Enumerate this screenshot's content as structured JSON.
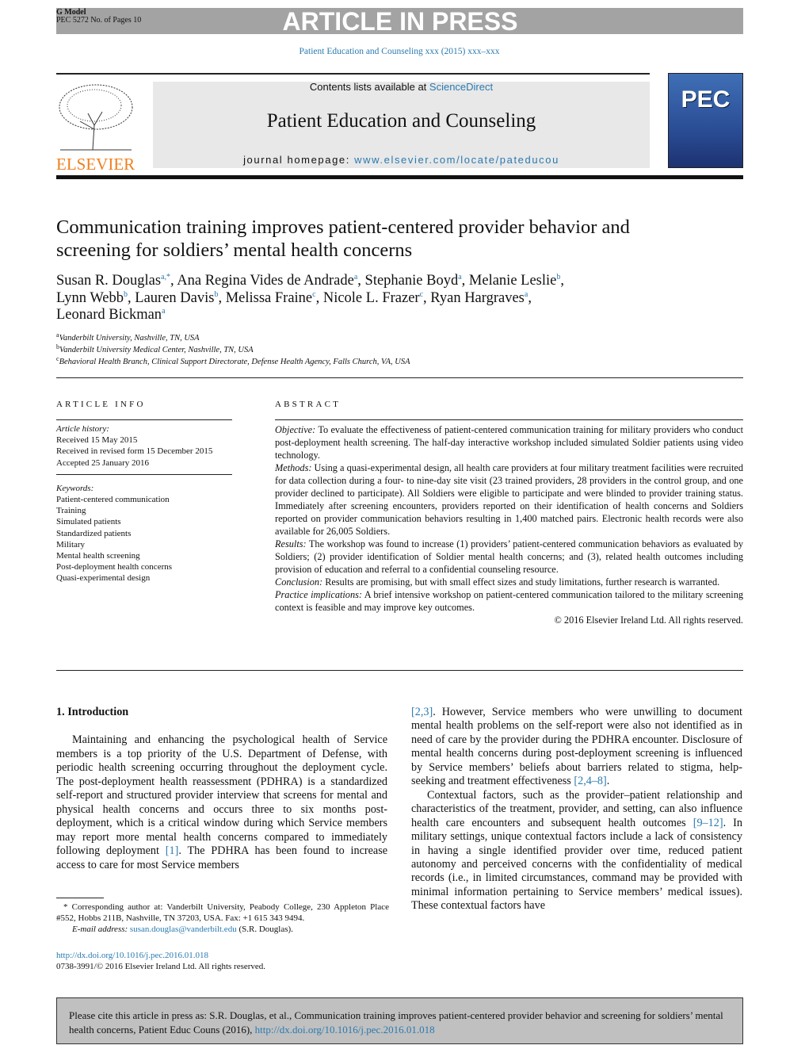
{
  "header": {
    "gmodel": "G Model",
    "pec_pages": "PEC 5272 No. of Pages 10",
    "banner": "ARTICLE IN PRESS",
    "journal_ref": "Patient Education and Counseling xxx (2015) xxx–xxx",
    "contents_prefix": "Contents lists available at ",
    "sciencedirect": "ScienceDirect",
    "journal_title": "Patient Education and Counseling",
    "homepage_prefix": "journal homepage: ",
    "homepage_url": "www.elsevier.com/locate/pateducou",
    "publisher_logo": "ELSEVIER",
    "cover_logo": "PEC"
  },
  "article": {
    "title": "Communication training improves patient-centered provider behavior and screening for soldiers’ mental health concerns",
    "authors": [
      {
        "name": "Susan R. Douglas",
        "sup": "a,*"
      },
      {
        "name": "Ana Regina Vides de Andrade",
        "sup": "a"
      },
      {
        "name": "Stephanie Boyd",
        "sup": "a"
      },
      {
        "name": "Melanie Leslie",
        "sup": "b"
      },
      {
        "name": "Lynn Webb",
        "sup": "b"
      },
      {
        "name": "Lauren Davis",
        "sup": "b"
      },
      {
        "name": "Melissa Fraine",
        "sup": "c"
      },
      {
        "name": "Nicole L. Frazer",
        "sup": "c"
      },
      {
        "name": "Ryan Hargraves",
        "sup": "a"
      },
      {
        "name": "Leonard Bickman",
        "sup": "a"
      }
    ],
    "affiliations": [
      {
        "sup": "a",
        "text": "Vanderbilt University, Nashville, TN, USA"
      },
      {
        "sup": "b",
        "text": "Vanderbilt University Medical Center, Nashville, TN, USA"
      },
      {
        "sup": "c",
        "text": "Behavioral Health Branch, Clinical Support Directorate, Defense Health Agency, Falls Church, VA, USA"
      }
    ]
  },
  "article_info": {
    "heading": "ARTICLE INFO",
    "history_label": "Article history:",
    "history": [
      "Received 15 May 2015",
      "Received in revised form 15 December 2015",
      "Accepted 25 January 2016"
    ],
    "keywords_label": "Keywords:",
    "keywords": [
      "Patient-centered communication",
      "Training",
      "Simulated patients",
      "Standardized patients",
      "Military",
      "Mental health screening",
      "Post-deployment health concerns",
      "Quasi-experimental design"
    ]
  },
  "abstract": {
    "heading": "ABSTRACT",
    "sections": [
      {
        "label": "Objective:",
        "text": " To evaluate the effectiveness of patient-centered communication training for military providers who conduct post-deployment health screening. The half-day interactive workshop included simulated Soldier patients using video technology."
      },
      {
        "label": "Methods:",
        "text": " Using a quasi-experimental design, all health care providers at four military treatment facilities were recruited for data collection during a four- to nine-day site visit (23 trained providers, 28 providers in the control group, and one provider declined to participate). All Soldiers were eligible to participate and were blinded to provider training status. Immediately after screening encounters, providers reported on their identification of health concerns and Soldiers reported on provider communication behaviors resulting in 1,400 matched pairs. Electronic health records were also available for 26,005 Soldiers."
      },
      {
        "label": "Results:",
        "text": " The workshop was found to increase (1) providers’ patient-centered communication behaviors as evaluated by Soldiers; (2) provider identification of Soldier mental health concerns; and (3), related health outcomes including provision of education and referral to a confidential counseling resource."
      },
      {
        "label": "Conclusion:",
        "text": " Results are promising, but with small effect sizes and study limitations, further research is warranted."
      },
      {
        "label": "Practice implications:",
        "text": " A brief intensive workshop on patient-centered communication tailored to the military screening context is feasible and may improve key outcomes."
      }
    ],
    "copyright": "© 2016 Elsevier Ireland Ltd. All rights reserved."
  },
  "body": {
    "section_heading": "1. Introduction",
    "left_p1_a": "Maintaining and enhancing the psychological health of Service members is a top priority of the U.S. Department of Defense, with periodic health screening occurring throughout the deployment cycle. The post-deployment health reassessment (PDHRA) is a standardized self-report and structured provider interview that screens for mental and physical health concerns and occurs three to six months post-deployment, which is a critical window during which Service members may report more mental health concerns compared to immediately following deployment ",
    "ref1": "[1]",
    "left_p1_b": ". The PDHRA has been found to increase access to care for most Service members",
    "ref2": "[2,3]",
    "right_p1_a": ". However, Service members who were unwilling to document mental health problems on the self-report were also not identified as in need of care by the provider during the PDHRA encounter. Disclosure of mental health concerns during post-deployment screening is influenced by Service members’ beliefs about barriers related to stigma, help-seeking and treatment effectiveness ",
    "ref3": "[2,4–8]",
    "right_p1_b": ".",
    "right_p2_a": "Contextual factors, such as the provider–patient relationship and characteristics of the treatment, provider, and setting, can also influence health care encounters and subsequent health outcomes ",
    "ref4": "[9–12]",
    "right_p2_b": ". In military settings, unique contextual factors include a lack of consistency in having a single identified provider over time, reduced patient autonomy and perceived concerns with the confidentiality of medical records (i.e., in limited circumstances, command may be provided with minimal information pertaining to Service members’ medical issues). These contextual factors have"
  },
  "footnote": {
    "star": "*",
    "text": " Corresponding author at: Vanderbilt University, Peabody College, 230 Appleton Place #552, Hobbs 211B, Nashville, TN 37203, USA. Fax: +1 615 343 9494.",
    "email_label": "E-mail address:",
    "email": "susan.douglas@vanderbilt.edu",
    "email_suffix": " (S.R. Douglas)."
  },
  "doi": {
    "url": "http://dx.doi.org/10.1016/j.pec.2016.01.018",
    "issn": "0738-3991/© 2016 Elsevier Ireland Ltd. All rights reserved."
  },
  "cite_box": {
    "text": "Please cite this article in press as: S.R. Douglas, et al., Communication training improves patient-centered provider behavior and screening for soldiers’ mental health concerns, Patient Educ Couns (2016), ",
    "url": "http://dx.doi.org/10.1016/j.pec.2016.01.018"
  }
}
